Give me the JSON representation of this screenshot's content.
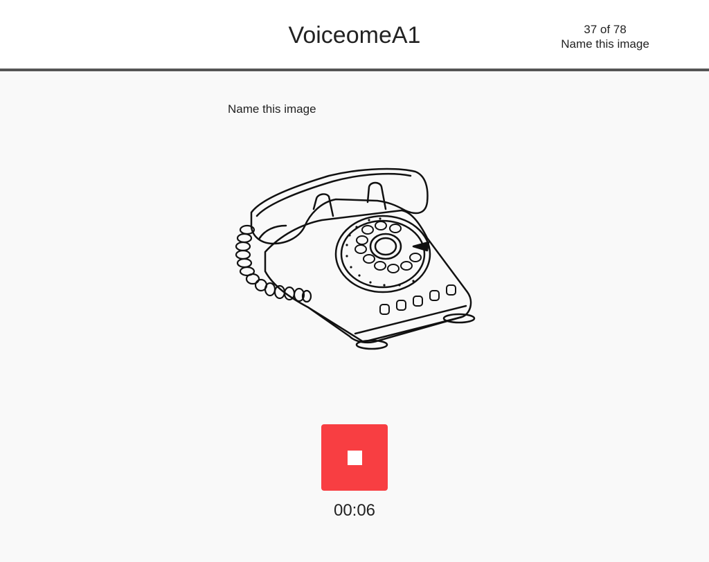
{
  "header": {
    "app_title": "VoiceomeA1",
    "progress": "37 of 78",
    "task_name": "Name this image"
  },
  "main": {
    "prompt": "Name this image",
    "stimulus_icon": "rotary-telephone-icon"
  },
  "recorder": {
    "button_icon": "stop-icon",
    "elapsed": "00:06",
    "accent_color": "#f83e42"
  }
}
